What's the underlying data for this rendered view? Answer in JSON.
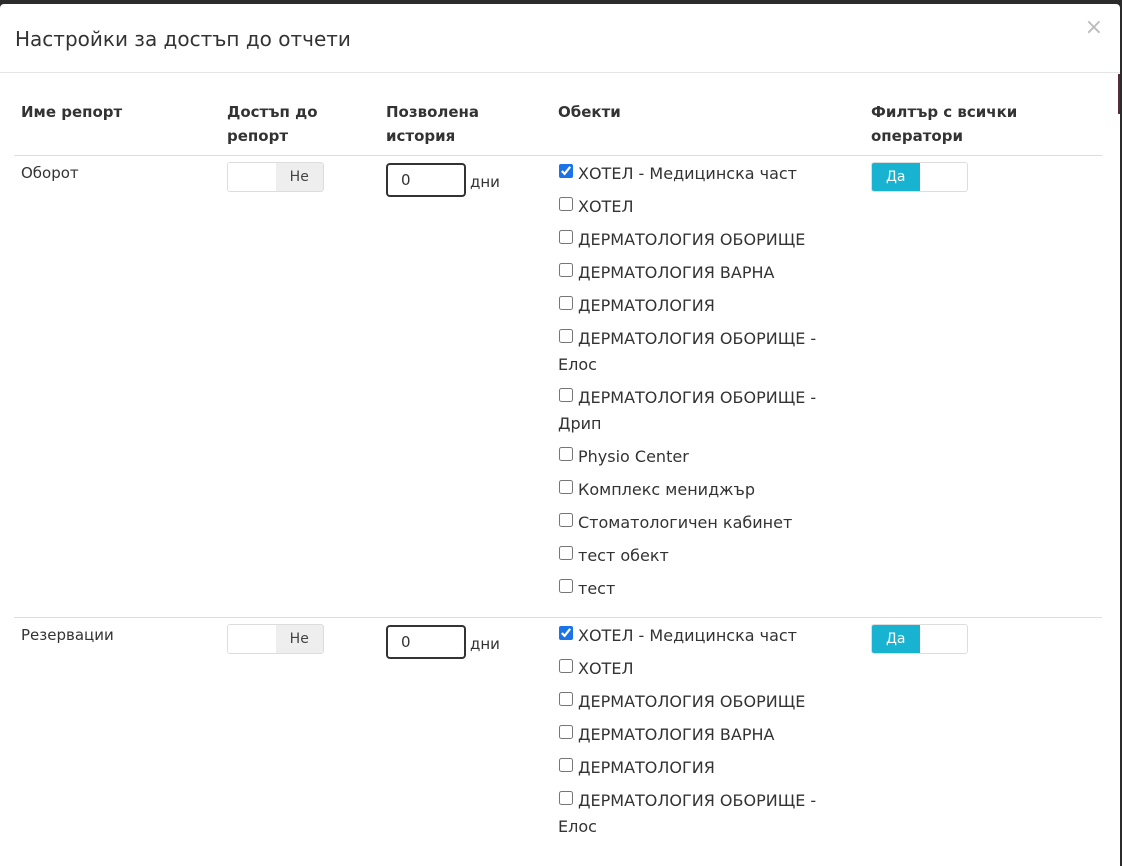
{
  "modal": {
    "title": "Настройки за достъп до отчети",
    "close_glyph": "×"
  },
  "table": {
    "headers": {
      "name": "Име репорт",
      "access": "Достъп до репорт",
      "history": "Позволена история",
      "objects": "Обекти",
      "filter": "Филтър с всички оператори"
    },
    "rows": [
      {
        "name": "Оборот",
        "access_label": "Не",
        "history_value": "0",
        "days_label": "дни",
        "filter_label": "Да",
        "objects": [
          {
            "label": "ХОТЕЛ - Медицинска част",
            "checked": true
          },
          {
            "label": "ХОТЕЛ",
            "checked": false
          },
          {
            "label": "ДЕРМАТОЛОГИЯ ОБОРИЩЕ",
            "checked": false
          },
          {
            "label": "ДЕРМАТОЛОГИЯ ВАРНА",
            "checked": false
          },
          {
            "label": "ДЕРМАТОЛОГИЯ",
            "checked": false
          },
          {
            "label": "ДЕРМАТОЛОГИЯ ОБОРИЩЕ - Елос",
            "checked": false
          },
          {
            "label": "ДЕРМАТОЛОГИЯ ОБОРИЩЕ - Дрип",
            "checked": false
          },
          {
            "label": "Physio Center",
            "checked": false
          },
          {
            "label": "Комплекс мениджър",
            "checked": false
          },
          {
            "label": "Стоматологичен кабинет",
            "checked": false
          },
          {
            "label": "тест обект",
            "checked": false
          },
          {
            "label": "тест",
            "checked": false
          }
        ]
      },
      {
        "name": "Резервации",
        "access_label": "Не",
        "history_value": "0",
        "days_label": "дни",
        "filter_label": "Да",
        "objects": [
          {
            "label": "ХОТЕЛ - Медицинска част",
            "checked": true
          },
          {
            "label": "ХОТЕЛ",
            "checked": false
          },
          {
            "label": "ДЕРМАТОЛОГИЯ ОБОРИЩЕ",
            "checked": false
          },
          {
            "label": "ДЕРМАТОЛОГИЯ ВАРНА",
            "checked": false
          },
          {
            "label": "ДЕРМАТОЛОГИЯ",
            "checked": false
          },
          {
            "label": "ДЕРМАТОЛОГИЯ ОБОРИЩЕ - Елос",
            "checked": false
          }
        ]
      }
    ]
  },
  "colors": {
    "accent": "#17b3d0",
    "checkbox": "#1a73e8"
  }
}
